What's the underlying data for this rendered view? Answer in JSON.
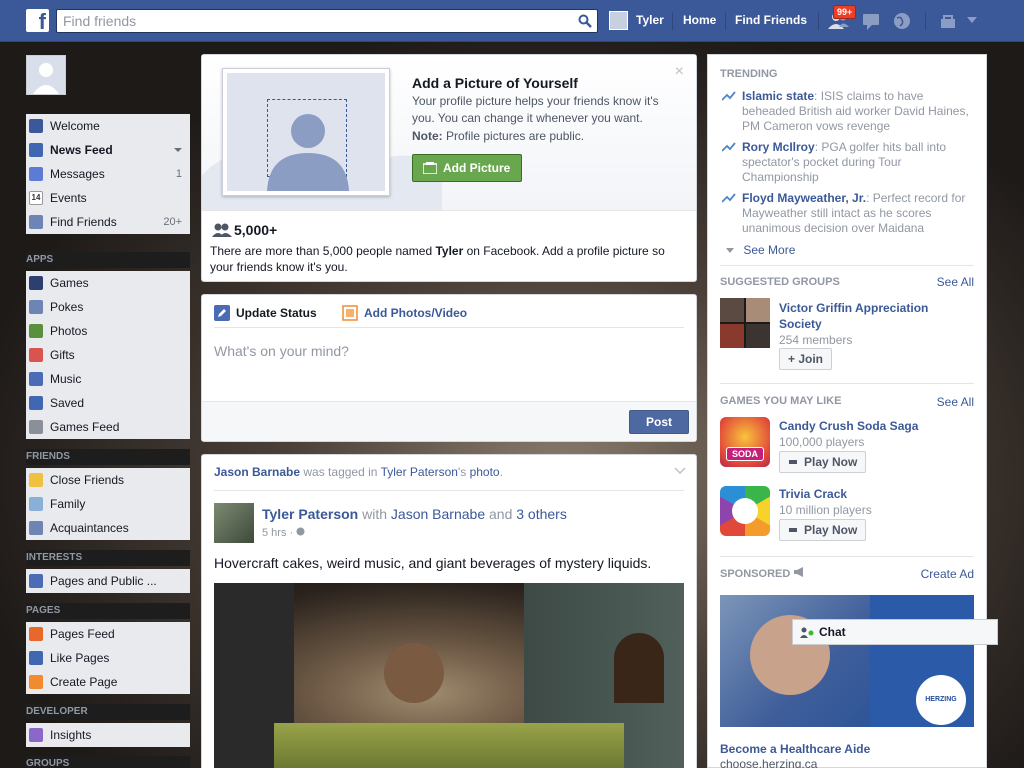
{
  "topbar": {
    "logo": "f",
    "search_placeholder": "Find friends",
    "user_name": "Tyler",
    "home": "Home",
    "find_friends": "Find Friends",
    "notif_badge": "99+"
  },
  "sidebar": {
    "main": [
      {
        "label": "Welcome",
        "icon": "facebook-icon"
      },
      {
        "label": "News Feed",
        "icon": "news-feed-icon"
      },
      {
        "label": "Messages",
        "icon": "messages-icon",
        "count": "1"
      },
      {
        "label": "Events",
        "icon": "calendar-icon",
        "icon_text": "14"
      },
      {
        "label": "Find Friends",
        "icon": "find-friends-icon",
        "count": "20+"
      }
    ],
    "apps_header": "APPS",
    "apps": [
      "Games",
      "Pokes",
      "Photos",
      "Gifts",
      "Music",
      "Saved",
      "Games Feed"
    ],
    "friends_header": "FRIENDS",
    "friends": [
      "Close Friends",
      "Family",
      "Acquaintances"
    ],
    "interests_header": "INTERESTS",
    "interests": [
      "Pages and Public ..."
    ],
    "pages_header": "PAGES",
    "pages": [
      "Pages Feed",
      "Like Pages",
      "Create Page"
    ],
    "developer_header": "DEVELOPER",
    "developer": [
      "Insights"
    ],
    "groups_header": "GROUPS"
  },
  "add_picture": {
    "title": "Add a Picture of Yourself",
    "body": "Your profile picture helps your friends know it's you. You can change it whenever you want.",
    "note_label": "Note:",
    "note_text": " Profile pictures are public.",
    "button": "Add Picture",
    "count": "5,000+",
    "info_pre": "There are more than 5,000 people named ",
    "info_name": "Tyler",
    "info_post": " on Facebook. Add a profile picture so your friends know it's you.",
    "close": "×"
  },
  "composer": {
    "update_status": "Update Status",
    "add_photos": "Add Photos/Video",
    "placeholder": "What's on your mind?",
    "post": "Post"
  },
  "story": {
    "header_actor": "Jason Barnabe",
    "header_mid": " was tagged in ",
    "header_owner": "Tyler Paterson",
    "header_possessive": "'s ",
    "header_photo": "photo",
    "header_end": ".",
    "author": "Tyler Paterson",
    "with_text": " with ",
    "tagged": "Jason Barnabe",
    "and_text": " and ",
    "others": "3 others",
    "time": "5 hrs · ",
    "text": "Hovercraft cakes, weird music, and giant beverages of mystery liquids."
  },
  "right": {
    "trending_header": "TRENDING",
    "trends": [
      {
        "topic": "Islamic state",
        "desc": ": ISIS claims to have beheaded British aid worker David Haines, PM Cameron vows revenge"
      },
      {
        "topic": "Rory McIlroy",
        "desc": ": PGA golfer hits ball into spectator's pocket during Tour Championship"
      },
      {
        "topic": "Floyd Mayweather, Jr.",
        "desc": ": Perfect record for Mayweather still intact as he scores unanimous decision over Maidana"
      }
    ],
    "see_more": "See More",
    "groups_header": "SUGGESTED GROUPS",
    "see_all": "See All",
    "group_name": "Victor Griffin Appreciation Society",
    "group_members": "254 members",
    "join": "+ Join",
    "games_header": "GAMES YOU MAY LIKE",
    "games": [
      {
        "name": "Candy Crush Soda Saga",
        "players": "100,000 players",
        "play": "Play Now",
        "logo_text": "SODA"
      },
      {
        "name": "Trivia Crack",
        "players": "10 million players",
        "play": "Play Now"
      }
    ],
    "sponsored_header": "SPONSORED",
    "create_ad": "Create Ad",
    "ad_title": "Become a Healthcare Aide",
    "ad_url": "choose.herzing.ca",
    "ad_logo": "HERZING"
  },
  "chat": {
    "label": "Chat"
  },
  "colors": {
    "brand": "#3b5998",
    "green": "#69a74e",
    "badge": "#f03d25"
  }
}
